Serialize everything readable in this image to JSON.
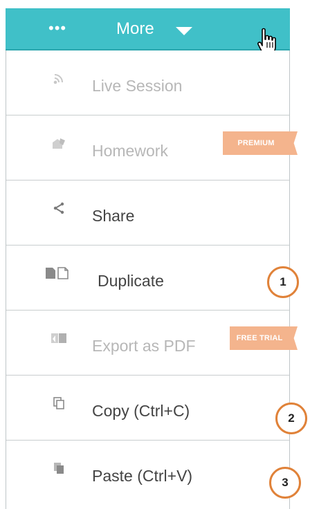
{
  "header": {
    "dots": "•••",
    "title": "More",
    "accent_color": "#40c0c8"
  },
  "menu": {
    "items": [
      {
        "label": "Live Session",
        "icon": "broadcast-icon",
        "enabled": false
      },
      {
        "label": "Homework",
        "icon": "homework-icon",
        "enabled": false,
        "badge": "PREMIUM"
      },
      {
        "label": "Share",
        "icon": "share-icon",
        "enabled": true
      },
      {
        "label": "Duplicate",
        "icon": "duplicate-icon",
        "enabled": true
      },
      {
        "label": "Export as PDF",
        "icon": "export-pdf-icon",
        "enabled": false,
        "badge": "FREE TRIAL"
      },
      {
        "label": "Copy (Ctrl+C)",
        "icon": "copy-icon",
        "enabled": true
      },
      {
        "label": "Paste (Ctrl+V)",
        "icon": "paste-icon",
        "enabled": true
      }
    ]
  },
  "annotations": {
    "step1": "1",
    "step2": "2",
    "step3": "3",
    "color": "#e08239"
  },
  "badge_color": "#f4b48d"
}
